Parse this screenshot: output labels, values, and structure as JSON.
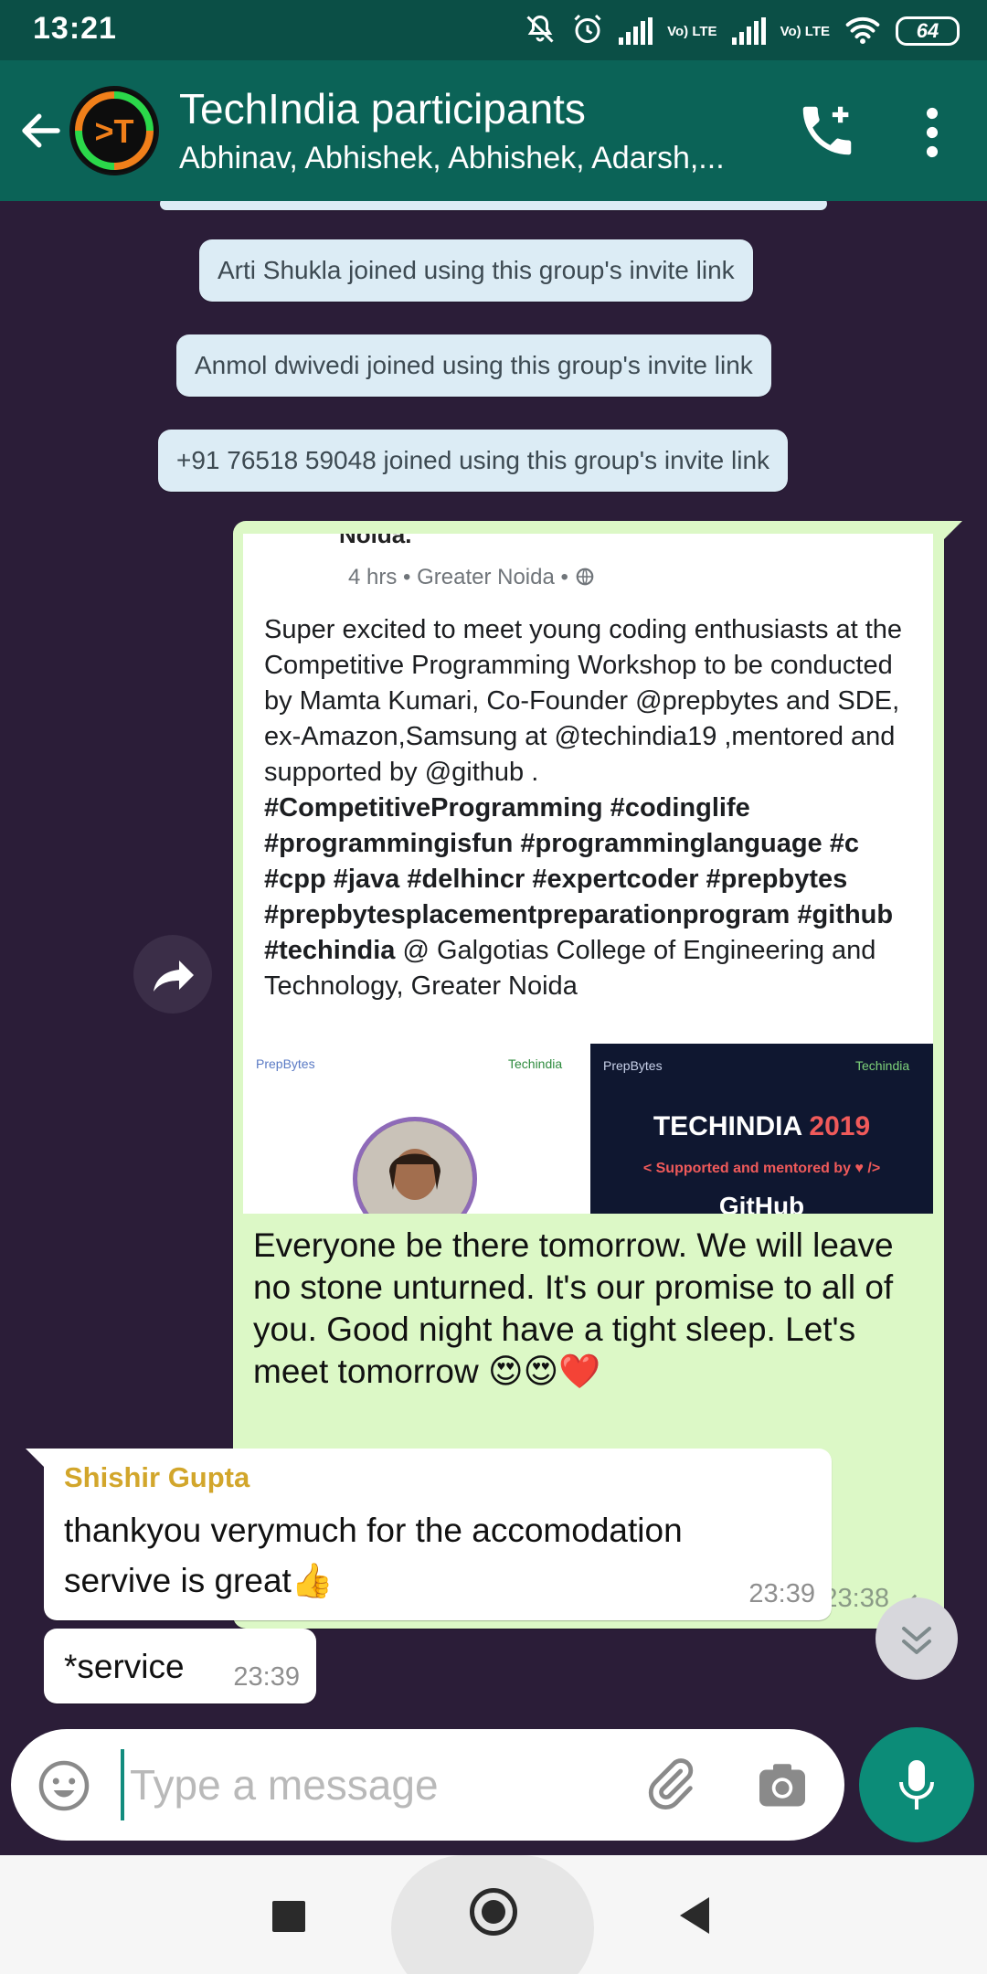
{
  "status_bar": {
    "time": "13:21",
    "lte1": "Vo) LTE",
    "lte2": "Vo) LTE",
    "battery": "64",
    "icons": [
      "mute-icon",
      "alarm-icon",
      "signal-icon",
      "signal-icon",
      "wifi-icon",
      "battery-icon"
    ]
  },
  "header": {
    "title": "TechIndia participants",
    "subtitle": "Abhinav, Abhishek, Abhishek, Adarsh,...",
    "logo_text": ">T",
    "colors": {
      "bar": "#0b6357",
      "status": "#0b4f46"
    }
  },
  "system_messages": [
    "Arti Shukla joined using this group's invite link",
    "Anmol dwivedi joined using this group's invite link",
    "+91 76518 59048 joined using this group's invite link"
  ],
  "outgoing": {
    "preview": {
      "cut_title": "Noida.",
      "meta": "4 hrs • Greater Noida •",
      "text_intro": "Super excited to meet young coding enthusiasts at the Competitive Programming Workshop to be conducted by Mamta Kumari, Co-Founder @prepbytes and SDE, ex-Amazon,Samsung at @techindia19 ,mentored and supported by @github .",
      "hashtags": "#CompetitiveProgramming #codinglife #programmingisfun #programminglanguage #c #cpp #java #delhincr #expertcoder #prepbytes #prepbytesplacementpreparationprogram #github #techindia",
      "text_outro": " @ Galgotias College of Engineering and Technology, Greater Noida",
      "image_left": {
        "brand": "PrepBytes",
        "partner": "Techindia"
      },
      "image_right": {
        "brand": "PrepBytes",
        "partner": "Techindia",
        "headline": "TECHINDIA",
        "year": "2019",
        "support": "< Supported and mentored by ♥ />",
        "github": "GitHub"
      }
    },
    "text": "Everyone be there tomorrow. We will leave no stone unturned. It's our promise to all of you. Good night have a tight sleep. Let's meet tomorrow 😍😍❤️",
    "time": "23:38",
    "status": "sent"
  },
  "incoming": [
    {
      "sender": "Shishir Gupta",
      "text": "thankyou verymuch for the accomodation servive is great👍",
      "time": "23:39"
    },
    {
      "text": "*service",
      "time": "23:39"
    }
  ],
  "composer": {
    "placeholder": "Type a message",
    "value": ""
  },
  "colors": {
    "chat_bg": "#2b1d38",
    "outgoing_bubble": "#dcf8c6",
    "incoming_bubble": "#ffffff",
    "sender_name": "#d2a62b",
    "accent": "#0c8c78",
    "system_bubble": "#dcecf5"
  }
}
